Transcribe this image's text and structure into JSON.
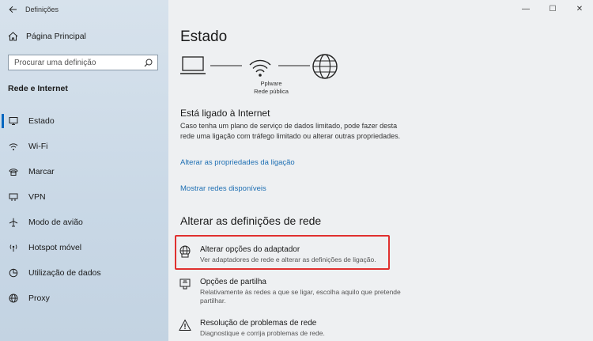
{
  "window": {
    "app_title": "Definições",
    "back_icon": "arrow-left-icon",
    "controls": {
      "minimize": "—",
      "maximize": "☐",
      "close": "✕"
    }
  },
  "sidebar": {
    "home_label": "Página Principal",
    "search_placeholder": "Procurar uma definição",
    "section_title": "Rede e Internet",
    "items": [
      {
        "label": "Estado",
        "icon": "status-icon",
        "active": true
      },
      {
        "label": "Wi-Fi",
        "icon": "wifi-icon",
        "active": false
      },
      {
        "label": "Marcar",
        "icon": "dialup-icon",
        "active": false
      },
      {
        "label": "VPN",
        "icon": "vpn-icon",
        "active": false
      },
      {
        "label": "Modo de avião",
        "icon": "airplane-icon",
        "active": false
      },
      {
        "label": "Hotspot móvel",
        "icon": "hotspot-icon",
        "active": false
      },
      {
        "label": "Utilização de dados",
        "icon": "data-usage-icon",
        "active": false
      },
      {
        "label": "Proxy",
        "icon": "globe-icon",
        "active": false
      }
    ]
  },
  "main": {
    "title": "Estado",
    "network": {
      "name": "Pplware",
      "type": "Rede pública"
    },
    "status_heading": "Está ligado à Internet",
    "status_description": "Caso tenha um plano de serviço de dados limitado, pode fazer desta rede uma ligação com tráfego limitado ou alterar outras propriedades.",
    "link_properties": "Alterar as propriedades da ligação",
    "link_networks": "Mostrar redes disponíveis",
    "section_heading": "Alterar as definições de rede",
    "options": [
      {
        "title": "Alterar opções do adaptador",
        "description": "Ver adaptadores de rede e alterar as definições de ligação.",
        "icon": "adapter-icon"
      },
      {
        "title": "Opções de partilha",
        "description": "Relativamente às redes a que se ligar, escolha aquilo que pretende partilhar.",
        "icon": "sharing-icon"
      },
      {
        "title": "Resolução de problemas de rede",
        "description": "Diagnostique e corrija problemas de rede.",
        "icon": "warning-icon"
      }
    ]
  },
  "colors": {
    "accent": "#0067c0",
    "link": "#1e6fb3",
    "highlight": "#e0302f"
  }
}
